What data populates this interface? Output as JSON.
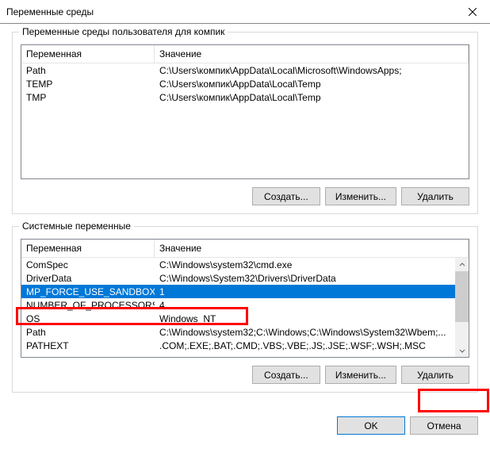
{
  "title": "Переменные среды",
  "group_user": {
    "title": "Переменные среды пользователя для компик",
    "headers": {
      "name": "Переменная",
      "value": "Значение"
    },
    "rows": [
      {
        "name": "Path",
        "value": "C:\\Users\\компик\\AppData\\Local\\Microsoft\\WindowsApps;"
      },
      {
        "name": "TEMP",
        "value": "C:\\Users\\компик\\AppData\\Local\\Temp"
      },
      {
        "name": "TMP",
        "value": "C:\\Users\\компик\\AppData\\Local\\Temp"
      }
    ],
    "buttons": {
      "new": "Создать...",
      "edit": "Изменить...",
      "delete": "Удалить"
    }
  },
  "group_system": {
    "title": "Системные переменные",
    "headers": {
      "name": "Переменная",
      "value": "Значение"
    },
    "rows": [
      {
        "name": "ComSpec",
        "value": "C:\\Windows\\system32\\cmd.exe"
      },
      {
        "name": "DriverData",
        "value": "C:\\Windows\\System32\\Drivers\\DriverData"
      },
      {
        "name": "MP_FORCE_USE_SANDBOX",
        "value": "1",
        "selected": true
      },
      {
        "name": "NUMBER_OF_PROCESSORS",
        "value": "4"
      },
      {
        "name": "OS",
        "value": "Windows_NT"
      },
      {
        "name": "Path",
        "value": "C:\\Windows\\system32;C:\\Windows;C:\\Windows\\System32\\Wbem;..."
      },
      {
        "name": "PATHEXT",
        "value": ".COM;.EXE;.BAT;.CMD;.VBS;.VBE;.JS;.JSE;.WSF;.WSH;.MSC"
      }
    ],
    "buttons": {
      "new": "Создать...",
      "edit": "Изменить...",
      "delete": "Удалить"
    }
  },
  "dialog_buttons": {
    "ok": "OK",
    "cancel": "Отмена"
  }
}
